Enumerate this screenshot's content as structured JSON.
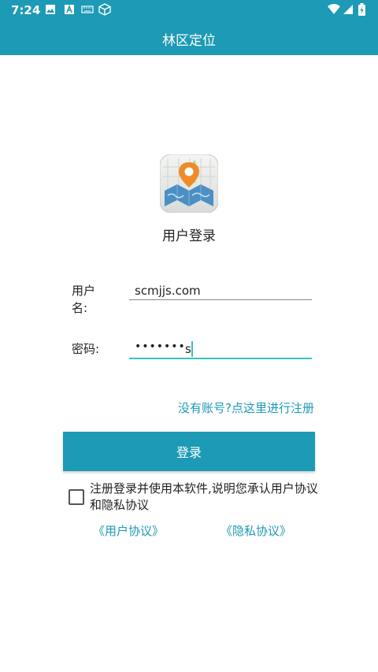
{
  "status_bar": {
    "time": "7:24"
  },
  "app_bar": {
    "title": "林区定位"
  },
  "login": {
    "heading": "用户登录",
    "username_label": "用户名:",
    "username_value": "scmjjs.com",
    "password_label": "密码:",
    "password_masked": "•••••••",
    "password_last_char": "s",
    "register_link": "没有账号?点这里进行注册",
    "login_button": "登录",
    "agree_text": "注册登录并使用本软件,说明您承认用户协议和隐私协议",
    "user_agreement_link": "《用户协议》",
    "privacy_link": "《隐私协议》",
    "agree_checked": false
  },
  "colors": {
    "primary": "#1d9ab5",
    "accent": "#35c4c1"
  },
  "icons": [
    "image-icon",
    "a-icon",
    "keyboard-icon",
    "cube-icon",
    "wifi-icon",
    "signal-icon",
    "battery-icon",
    "app-map-pin-logo"
  ]
}
